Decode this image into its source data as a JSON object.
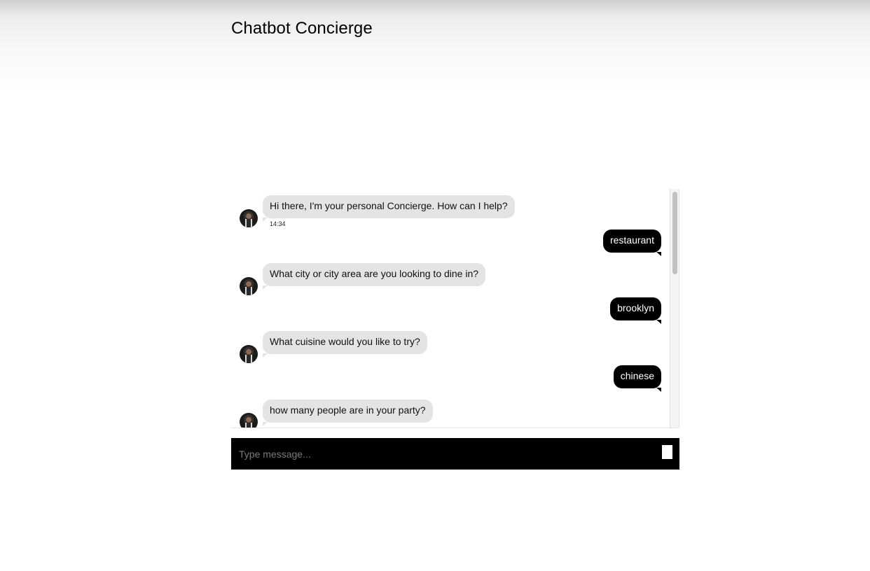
{
  "header": {
    "title": "Chatbot Concierge"
  },
  "conversation": {
    "messages": [
      {
        "sender": "bot",
        "text": "Hi there, I'm your personal Concierge. How can I help?",
        "time": "14:34"
      },
      {
        "sender": "user",
        "text": "restaurant"
      },
      {
        "sender": "bot",
        "text": "What city or city area are you looking to dine in?"
      },
      {
        "sender": "user",
        "text": "brooklyn"
      },
      {
        "sender": "bot",
        "text": "What cuisine would you like to try?"
      },
      {
        "sender": "user",
        "text": "chinese"
      },
      {
        "sender": "bot",
        "text": "how many people are in your party?"
      }
    ]
  },
  "composer": {
    "placeholder": "Type message...",
    "value": ""
  },
  "icons": {
    "avatar": "concierge-avatar",
    "send": "send-icon"
  }
}
